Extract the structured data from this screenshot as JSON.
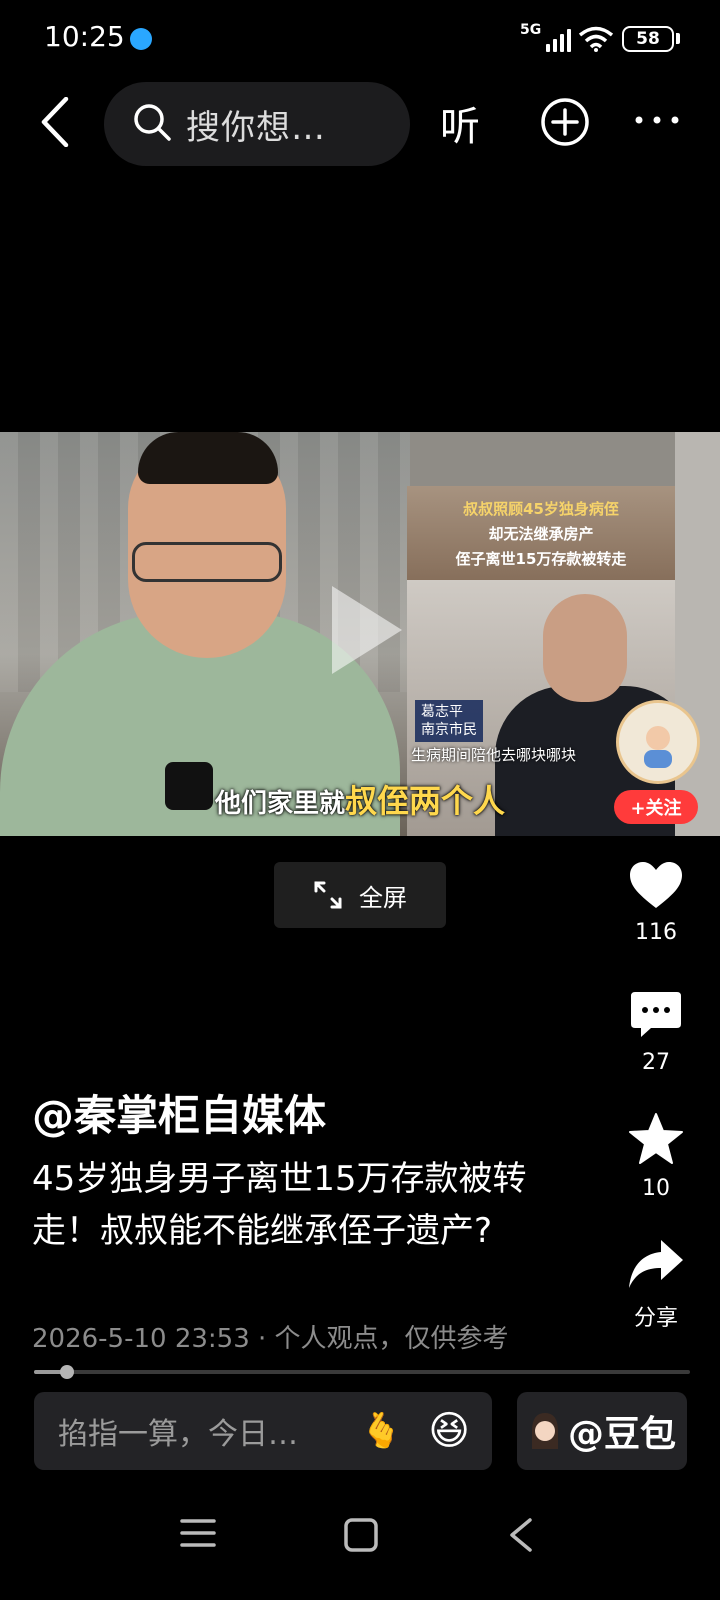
{
  "status_bar": {
    "time": "10:25",
    "network": "5G",
    "battery": "58"
  },
  "top_bar": {
    "search_placeholder": "搜你想…",
    "listen_label": "听"
  },
  "video": {
    "inset_title_1": "叔叔照顾45岁独身病侄",
    "inset_title_2": "却无法继承房产",
    "inset_title_3": "侄子离世15万存款被转走",
    "name_card_name": "葛志平",
    "name_card_role": "南京市民",
    "inset_caption": "生病期间陪他去哪块哪块",
    "subtitle_prefix": "他们家里就",
    "subtitle_highlight": "叔侄两个人",
    "follow_label": "+关注"
  },
  "fullscreen_label": "全屏",
  "actions": {
    "likes": "116",
    "comments": "27",
    "favorites": "10",
    "share_label": "分享"
  },
  "post": {
    "author": "@秦掌柜自媒体",
    "description": "45岁独身男子离世15万存款被转走！叔叔能不能继承侄子遗产?",
    "meta": "2026-5-10 23:53 · 个人观点，仅供参考"
  },
  "progress": {
    "fraction": 0.05
  },
  "bottom": {
    "ai_placeholder": "掐指一算，今日…",
    "emoji_1": "🫰",
    "emoji_2": "😆",
    "doubao_label": "@豆包"
  }
}
